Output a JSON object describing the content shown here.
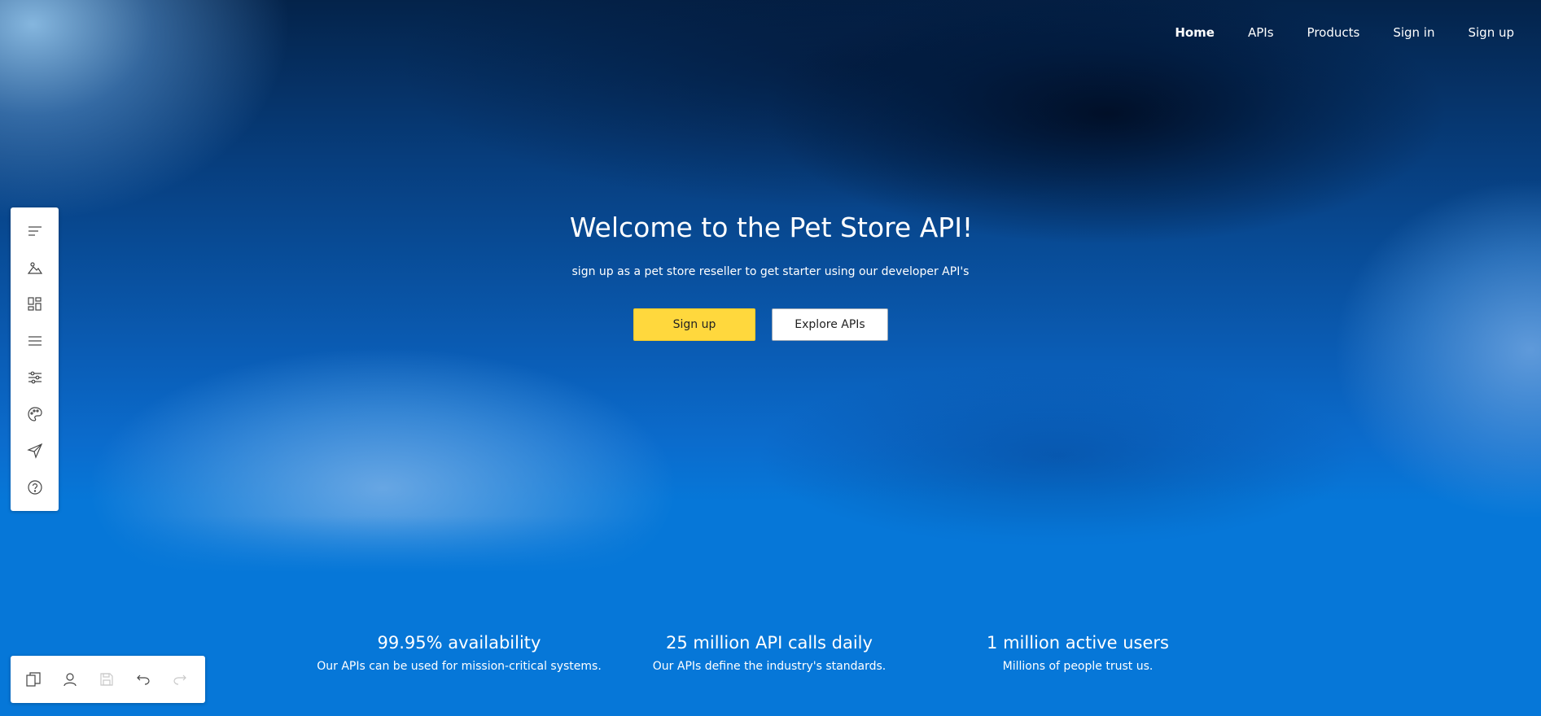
{
  "nav": {
    "items": [
      {
        "label": "Home",
        "active": true
      },
      {
        "label": "APIs",
        "active": false
      },
      {
        "label": "Products",
        "active": false
      },
      {
        "label": "Sign in",
        "active": false
      },
      {
        "label": "Sign up",
        "active": false
      }
    ]
  },
  "hero": {
    "title": "Welcome to the Pet Store API!",
    "subtitle": "sign up as a pet store reseller to get starter using our developer API's",
    "primary_button": "Sign up",
    "secondary_button": "Explore APIs"
  },
  "stats": [
    {
      "headline": "99.95% availability",
      "caption": "Our APIs can be used for mission-critical systems."
    },
    {
      "headline": "25 million API calls daily",
      "caption": "Our APIs define the industry's standards."
    },
    {
      "headline": "1 million active users",
      "caption": "Millions of people trust us."
    }
  ],
  "side_toolbar": {
    "icons": [
      "text-icon",
      "image-icon",
      "layout-icon",
      "menu-icon",
      "sliders-icon",
      "palette-icon",
      "send-icon",
      "help-icon"
    ]
  },
  "bottom_toolbar": {
    "icons": [
      "pages-icon",
      "user-icon",
      "save-icon",
      "undo-icon",
      "redo-icon"
    ]
  },
  "colors": {
    "primary_button": "#ffd83d",
    "background_blue": "#0677d8"
  }
}
